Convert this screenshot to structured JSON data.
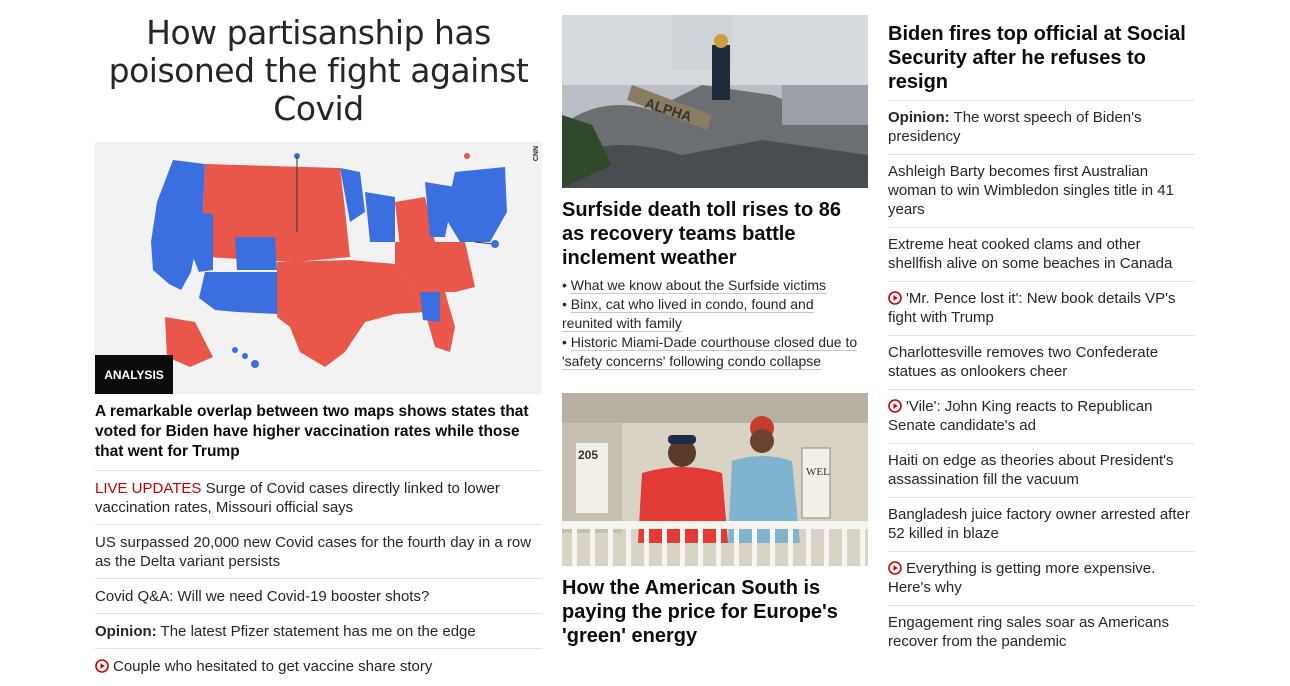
{
  "col1": {
    "headline": "How partisanship has poisoned the fight against Covid",
    "badge": "ANALYSIS",
    "map_watermark": "CNN",
    "lead_caption": "A remarkable overlap between two maps shows states that voted for Biden have higher vaccination rates while those that went for Trump",
    "items": [
      {
        "prefix": "LIVE UPDATES",
        "text": " Surge of Covid cases directly linked to lower vaccination rates, Missouri official says"
      },
      {
        "text": "US surpassed 20,000 new Covid cases for the fourth day in a row as the Delta variant persists"
      },
      {
        "text": "Covid Q&A: Will we need Covid-19 booster shots?"
      },
      {
        "prefix": "Opinion:",
        "text": " The latest Pfizer statement has me on the edge"
      },
      {
        "text": "Couple who hesitated to get vaccine share story",
        "video": true
      }
    ]
  },
  "col2": {
    "story1": {
      "headline": "Surfside death toll rises to 86 as recovery teams battle inclement weather",
      "photo_text": "ALPHA",
      "bullets": [
        "What we know about the Surfside victims",
        "Binx, cat who lived in condo, found and reunited with family",
        "Historic Miami-Dade courthouse closed due to 'safety concerns' following condo collapse"
      ]
    },
    "story2": {
      "headline": "How the American South is paying the price for Europe's 'green' energy",
      "photo_text_number": "205",
      "photo_text_sign": "WEL"
    }
  },
  "col3": {
    "headline": "Biden fires top official at Social Security after he refuses to resign",
    "items": [
      {
        "prefix": "Opinion:",
        "text": " The worst speech of Biden's presidency"
      },
      {
        "text": "Ashleigh Barty becomes first Australian woman to win Wimbledon singles title in 41 years"
      },
      {
        "text": "Extreme heat cooked clams and other shellfish alive on some beaches in Canada"
      },
      {
        "text": "'Mr. Pence lost it': New book details VP's fight with Trump",
        "video": true
      },
      {
        "text": "Charlottesville removes two Confederate statues as onlookers cheer"
      },
      {
        "text": "'Vile': John King reacts to Republican Senate candidate's ad",
        "video": true
      },
      {
        "text": "Haiti on edge as theories about President's assassination fill the vacuum"
      },
      {
        "text": "Bangladesh juice factory owner arrested after 52 killed in blaze"
      },
      {
        "text": "Everything is getting more expensive. Here's why",
        "video": true
      },
      {
        "text": "Engagement ring sales soar as Americans recover from the pandemic"
      }
    ]
  },
  "colors": {
    "live": "#cc0000",
    "democrat": "#3b6fe0",
    "republican": "#e8574a",
    "badge": "#0c0c0c"
  }
}
